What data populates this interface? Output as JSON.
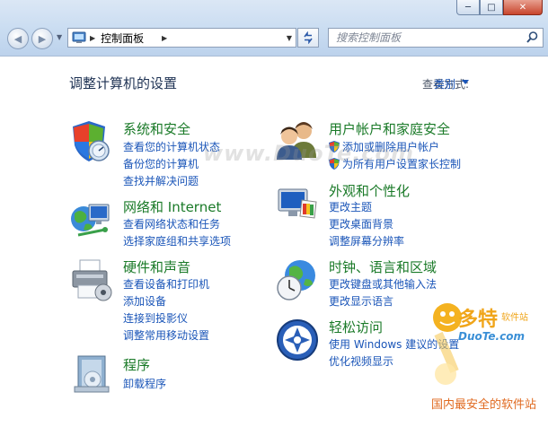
{
  "window": {
    "minimize": "─",
    "maximize": "□",
    "close": "✕"
  },
  "toolbar": {
    "breadcrumb": "控制面板",
    "search_placeholder": "搜索控制面板"
  },
  "main": {
    "title": "调整计算机的设置",
    "viewby_label": "查看方式:",
    "viewby_value": "类别"
  },
  "categories": [
    {
      "title": "系统和安全",
      "links": [
        "查看您的计算机状态",
        "备份您的计算机",
        "查找并解决问题"
      ]
    },
    {
      "title": "网络和 Internet",
      "links": [
        "查看网络状态和任务",
        "选择家庭组和共享选项"
      ]
    },
    {
      "title": "硬件和声音",
      "links": [
        "查看设备和打印机",
        "添加设备",
        "连接到投影仪",
        "调整常用移动设置"
      ]
    },
    {
      "title": "程序",
      "links": [
        "卸载程序"
      ]
    },
    {
      "title": "用户帐户和家庭安全",
      "links": [
        "添加或删除用户帐户",
        "为所有用户设置家长控制"
      ]
    },
    {
      "title": "外观和个性化",
      "links": [
        "更改主题",
        "更改桌面背景",
        "调整屏幕分辨率"
      ]
    },
    {
      "title": "时钟、语言和区域",
      "links": [
        "更改键盘或其他输入法",
        "更改显示语言"
      ]
    },
    {
      "title": "轻松访问",
      "links": [
        "使用 Windows 建议的设置",
        "优化视频显示"
      ]
    }
  ],
  "watermark": {
    "text": "www.DuoTe.com",
    "brand": "多特",
    "brand_small": "软件站",
    "brand_url": "DuoTe.com",
    "brand_tag": "国内最安全的软件站"
  },
  "colors": {
    "category_title": "#1a7a28",
    "link": "#1a55b8",
    "title_text": "#1e3253"
  }
}
